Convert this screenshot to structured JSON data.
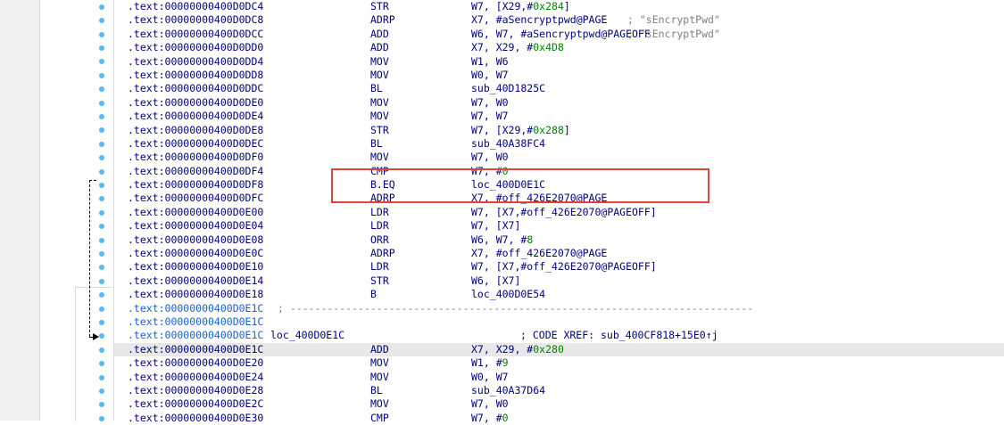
{
  "listing": {
    "rows": [
      {
        "addr": ".text:00000000400D0DC4",
        "mnemonic": "STR",
        "op": "W7, [X29,#0x284]",
        "comment": ""
      },
      {
        "addr": ".text:00000000400D0DC8",
        "mnemonic": "ADRP",
        "op": "X7, #aSencryptpwd@PAGE",
        "comment": "; \"sEncryptPwd\""
      },
      {
        "addr": ".text:00000000400D0DCC",
        "mnemonic": "ADD",
        "op": "W6, W7, #aSencryptpwd@PAGEOFF",
        "comment": "; \"sEncryptPwd\""
      },
      {
        "addr": ".text:00000000400D0DD0",
        "mnemonic": "ADD",
        "op": "X7, X29, #0x4D8",
        "comment": ""
      },
      {
        "addr": ".text:00000000400D0DD4",
        "mnemonic": "MOV",
        "op": "W1, W6",
        "comment": ""
      },
      {
        "addr": ".text:00000000400D0DD8",
        "mnemonic": "MOV",
        "op": "W0, W7",
        "comment": ""
      },
      {
        "addr": ".text:00000000400D0DDC",
        "mnemonic": "BL",
        "op": "sub_40D1825C",
        "comment": ""
      },
      {
        "addr": ".text:00000000400D0DE0",
        "mnemonic": "MOV",
        "op": "W7, W0",
        "comment": ""
      },
      {
        "addr": ".text:00000000400D0DE4",
        "mnemonic": "MOV",
        "op": "W7, W7",
        "comment": ""
      },
      {
        "addr": ".text:00000000400D0DE8",
        "mnemonic": "STR",
        "op": "W7, [X29,#0x288]",
        "comment": ""
      },
      {
        "addr": ".text:00000000400D0DEC",
        "mnemonic": "BL",
        "op": "sub_40A38FC4",
        "comment": ""
      },
      {
        "addr": ".text:00000000400D0DF0",
        "mnemonic": "MOV",
        "op": "W7, W0",
        "comment": ""
      },
      {
        "addr": ".text:00000000400D0DF4",
        "mnemonic": "CMP",
        "op": "W7, #0",
        "comment": ""
      },
      {
        "addr": ".text:00000000400D0DF8",
        "mnemonic": "B.EQ",
        "op": "loc_400D0E1C",
        "comment": ""
      },
      {
        "addr": ".text:00000000400D0DFC",
        "mnemonic": "ADRP",
        "op": "X7, #off_426E2070@PAGE",
        "comment": ""
      },
      {
        "addr": ".text:00000000400D0E00",
        "mnemonic": "LDR",
        "op": "W7, [X7,#off_426E2070@PAGEOFF]",
        "comment": ""
      },
      {
        "addr": ".text:00000000400D0E04",
        "mnemonic": "LDR",
        "op": "W7, [X7]",
        "comment": ""
      },
      {
        "addr": ".text:00000000400D0E08",
        "mnemonic": "ORR",
        "op": "W6, W7, #8",
        "comment": ""
      },
      {
        "addr": ".text:00000000400D0E0C",
        "mnemonic": "ADRP",
        "op": "X7, #off_426E2070@PAGE",
        "comment": ""
      },
      {
        "addr": ".text:00000000400D0E10",
        "mnemonic": "LDR",
        "op": "W7, [X7,#off_426E2070@PAGEOFF]",
        "comment": ""
      },
      {
        "addr": ".text:00000000400D0E14",
        "mnemonic": "STR",
        "op": "W6, [X7]",
        "comment": ""
      },
      {
        "addr": ".text:00000000400D0E18",
        "mnemonic": "B",
        "op": "loc_400D0E54",
        "comment": ""
      },
      {
        "addr": ".text:00000000400D0E1C",
        "kind": "separator",
        "sep": "; ---------------------------------------------------------------------------"
      },
      {
        "addr": ".text:00000000400D0E1C",
        "kind": "blank"
      },
      {
        "addr": ".text:00000000400D0E1C",
        "kind": "label",
        "label": "loc_400D0E1C",
        "xref": "; CODE XREF: sub_400CF818+15E0↑j"
      },
      {
        "addr": ".text:00000000400D0E1C",
        "mnemonic": "ADD",
        "op": "X7, X29, #0x280",
        "comment": "",
        "current": true
      },
      {
        "addr": ".text:00000000400D0E20",
        "mnemonic": "MOV",
        "op": "W1, #9",
        "comment": ""
      },
      {
        "addr": ".text:00000000400D0E24",
        "mnemonic": "MOV",
        "op": "W0, W7",
        "comment": ""
      },
      {
        "addr": ".text:00000000400D0E28",
        "mnemonic": "BL",
        "op": "sub_40A37D64",
        "comment": ""
      },
      {
        "addr": ".text:00000000400D0E2C",
        "mnemonic": "MOV",
        "op": "W7, W0",
        "comment": ""
      },
      {
        "addr": ".text:00000000400D0E30",
        "mnemonic": "CMP",
        "op": "W7, #0",
        "comment": ""
      }
    ]
  },
  "colors": {
    "address": "#000080",
    "label_address": "#1a5fd8",
    "immediate": "#008000",
    "comment": "#808080",
    "highlight_box": "#e0443a",
    "breakpoint_dot": "#5ab9f0",
    "current_line": "#e8e8e8"
  }
}
